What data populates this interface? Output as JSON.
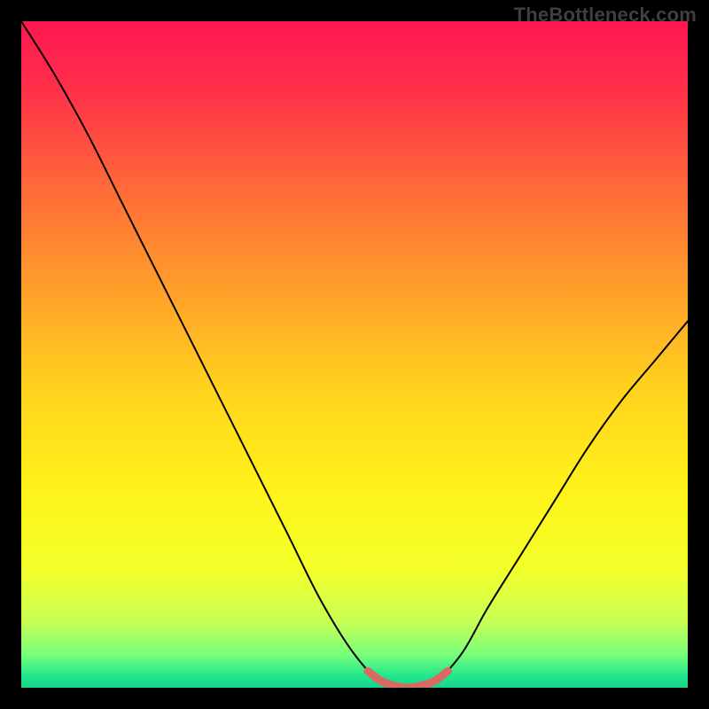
{
  "watermark": {
    "text": "TheBottleneck.com"
  },
  "chart_data": {
    "type": "line",
    "title": "",
    "xlabel": "",
    "ylabel": "",
    "xlim": [
      0,
      1
    ],
    "ylim": [
      0,
      100
    ],
    "series": [
      {
        "name": "bottleneck-curve",
        "x": [
          0.0,
          0.05,
          0.1,
          0.15,
          0.2,
          0.25,
          0.3,
          0.35,
          0.4,
          0.45,
          0.5,
          0.54,
          0.58,
          0.62,
          0.66,
          0.7,
          0.75,
          0.8,
          0.85,
          0.9,
          0.95,
          1.0
        ],
        "values": [
          100,
          92,
          83,
          73,
          63,
          53,
          43,
          33,
          23,
          13,
          5,
          1,
          0,
          1,
          5,
          12,
          20,
          28,
          36,
          43,
          49,
          55
        ]
      },
      {
        "name": "optimal-band",
        "x": [
          0.52,
          0.54,
          0.56,
          0.58,
          0.6,
          0.62,
          0.64
        ],
        "values": [
          2.5,
          1.0,
          0.3,
          0.0,
          0.3,
          1.0,
          2.5
        ]
      }
    ],
    "background_gradient_stops": [
      {
        "pos": 0.0,
        "color": "#ff1751"
      },
      {
        "pos": 0.1,
        "color": "#ff2f4a"
      },
      {
        "pos": 0.25,
        "color": "#ff6a39"
      },
      {
        "pos": 0.4,
        "color": "#ff9e2b"
      },
      {
        "pos": 0.55,
        "color": "#ffd21e"
      },
      {
        "pos": 0.7,
        "color": "#fff21a"
      },
      {
        "pos": 0.82,
        "color": "#f4ff2a"
      },
      {
        "pos": 0.9,
        "color": "#c8ff53"
      },
      {
        "pos": 0.95,
        "color": "#7aff7a"
      },
      {
        "pos": 0.98,
        "color": "#26e98d"
      },
      {
        "pos": 1.0,
        "color": "#17d48b"
      }
    ],
    "curve_stroke": "#000000",
    "band_stroke": "#d96a63",
    "legend": false,
    "grid": false
  }
}
